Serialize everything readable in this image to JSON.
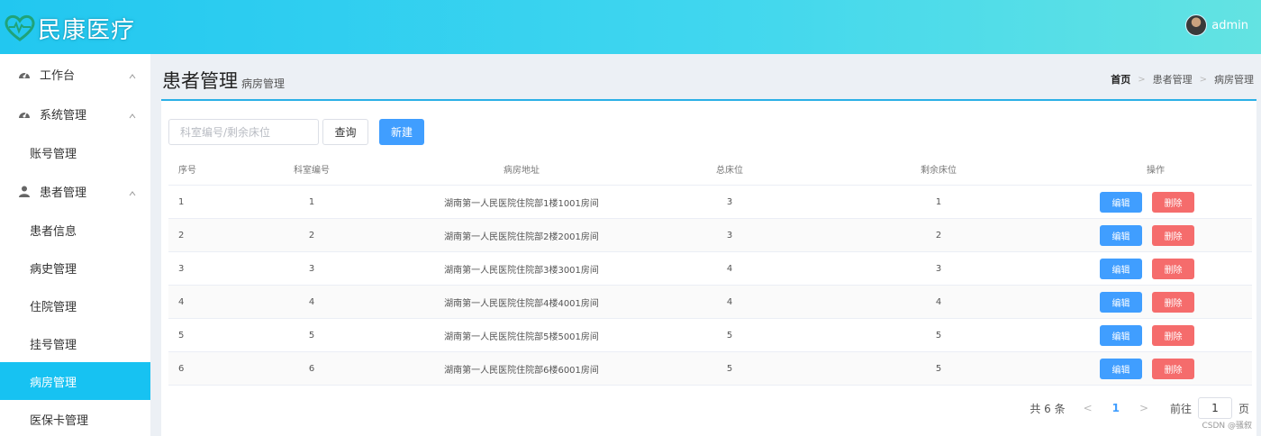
{
  "header": {
    "logo_text": "民康医疗",
    "username": "admin",
    "accent": "#22c7f0"
  },
  "sidebar": {
    "groups": [
      {
        "label": "工作台",
        "icon": "dashboard-icon"
      },
      {
        "label": "系统管理",
        "icon": "dashboard-icon"
      },
      {
        "label": "患者管理",
        "icon": "user-icon"
      }
    ],
    "items": [
      {
        "label": "账号管理"
      },
      {
        "label": "患者信息"
      },
      {
        "label": "病史管理"
      },
      {
        "label": "住院管理"
      },
      {
        "label": "挂号管理"
      },
      {
        "label": "病房管理"
      },
      {
        "label": "医保卡管理"
      }
    ],
    "active_color": "#17c2f2"
  },
  "page": {
    "title": "患者管理",
    "subtitle": "病房管理"
  },
  "breadcrumb": {
    "home": "首页",
    "level1": "患者管理",
    "level2": "病房管理"
  },
  "toolbar": {
    "search_placeholder": "科室编号/剩余床位",
    "query_label": "查询",
    "new_label": "新建"
  },
  "table": {
    "headers": [
      "序号",
      "科室编号",
      "病房地址",
      "总床位",
      "剩余床位",
      "操作"
    ],
    "rows": [
      {
        "seq": "1",
        "dept": "1",
        "addr": "湖南第一人民医院住院部1楼1001房间",
        "total": "3",
        "remain": "1"
      },
      {
        "seq": "2",
        "dept": "2",
        "addr": "湖南第一人民医院住院部2楼2001房间",
        "total": "3",
        "remain": "2"
      },
      {
        "seq": "3",
        "dept": "3",
        "addr": "湖南第一人民医院住院部3楼3001房间",
        "total": "4",
        "remain": "3"
      },
      {
        "seq": "4",
        "dept": "4",
        "addr": "湖南第一人民医院住院部4楼4001房间",
        "total": "4",
        "remain": "4"
      },
      {
        "seq": "5",
        "dept": "5",
        "addr": "湖南第一人民医院住院部5楼5001房间",
        "total": "5",
        "remain": "5"
      },
      {
        "seq": "6",
        "dept": "6",
        "addr": "湖南第一人民医院住院部6楼6001房间",
        "total": "5",
        "remain": "5"
      }
    ],
    "edit_label": "编辑",
    "delete_label": "删除"
  },
  "pagination": {
    "total_text": "共 6 条",
    "current_page": "1",
    "goto_label": "前往",
    "goto_value": "1",
    "page_unit": "页"
  },
  "watermark": "CSDN @骚叙"
}
